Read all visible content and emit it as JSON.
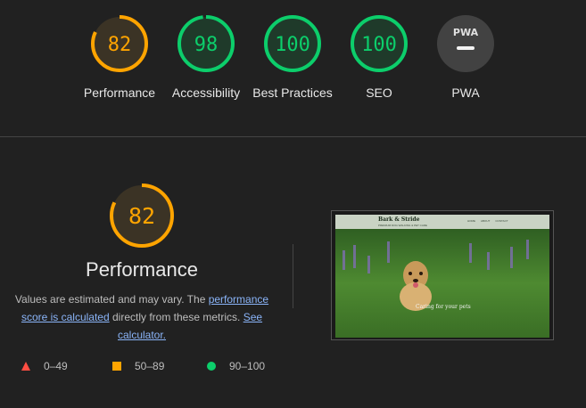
{
  "gauges": [
    {
      "score": "82",
      "value": 82,
      "label": "Performance",
      "color": "#ffa400",
      "track": "#3b3325"
    },
    {
      "score": "98",
      "value": 98,
      "label": "Accessibility",
      "color": "#0cce6b",
      "track": "#1f3a2a"
    },
    {
      "score": "100",
      "value": 100,
      "label": "Best Practices",
      "color": "#0cce6b",
      "track": "#1f3a2a"
    },
    {
      "score": "100",
      "value": 100,
      "label": "SEO",
      "color": "#0cce6b",
      "track": "#1f3a2a"
    },
    {
      "score": "PWA",
      "value": null,
      "label": "PWA",
      "color": "#e8e8e8",
      "track": "#424242"
    }
  ],
  "performance": {
    "score": "82",
    "value": 82,
    "title": "Performance",
    "desc_before": "Values are estimated and may vary. The ",
    "desc_link": "performance score is calculated",
    "desc_middle": " directly from these metrics. ",
    "desc_link2": "See calculator."
  },
  "legend": [
    {
      "range": "0–49",
      "color": "#ff4e42",
      "shape": "triangle"
    },
    {
      "range": "50–89",
      "color": "#ffa400",
      "shape": "square"
    },
    {
      "range": "90–100",
      "color": "#0cce6b",
      "shape": "circle"
    }
  ],
  "screenshot": {
    "brand": "Bark & Stride",
    "tagline": "PREMIUM DOG WALKING & PET CARE",
    "nav": [
      "HOME",
      "ABOUT",
      "CONTACT"
    ],
    "caption": "Caring for your pets"
  }
}
